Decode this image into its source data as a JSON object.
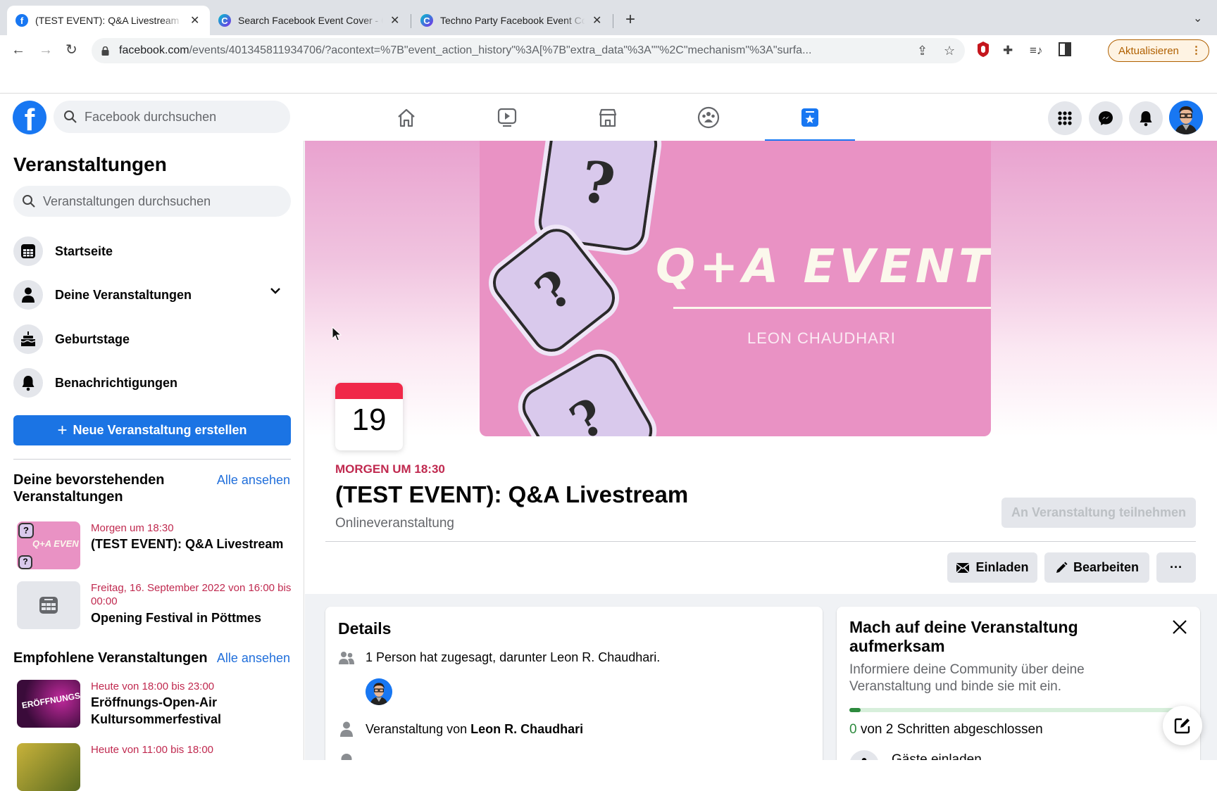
{
  "browser": {
    "tabs": [
      {
        "title": "(TEST EVENT): Q&A Livestream",
        "icon": "facebook-icon",
        "active": true
      },
      {
        "title": "Search Facebook Event Cover - Canva",
        "icon": "canva-icon",
        "active": false
      },
      {
        "title": "Techno Party Facebook Event Cover - Canva",
        "icon": "canva-icon",
        "active": false
      }
    ],
    "url_host": "facebook.com",
    "url_path": "/events/401345811934706/?acontext=%7B\"event_action_history\"%3A[%7B\"extra_data\"%3A\"\"%2C\"mechanism\"%3A\"surfa...",
    "update_label": "Aktualisieren"
  },
  "fb_header": {
    "search_placeholder": "Facebook durchsuchen",
    "nav": [
      "home-icon",
      "watch-icon",
      "marketplace-icon",
      "groups-icon",
      "events-icon"
    ],
    "active_nav": "events-icon"
  },
  "sidebar": {
    "title": "Veranstaltungen",
    "search_placeholder": "Veranstaltungen durchsuchen",
    "items": [
      {
        "label": "Startseite",
        "icon": "calendar-grid-icon"
      },
      {
        "label": "Deine Veranstaltungen",
        "icon": "person-icon",
        "expandable": true
      },
      {
        "label": "Geburtstage",
        "icon": "cake-icon"
      },
      {
        "label": "Benachrichtigungen",
        "icon": "bell-icon"
      }
    ],
    "create_label": "Neue Veranstaltung erstellen",
    "upcoming": {
      "title": "Deine bevorstehenden Veranstaltungen",
      "see_all": "Alle ansehen",
      "events": [
        {
          "when": "Morgen um 18:30",
          "name": "(TEST EVENT): Q&A Livestream"
        },
        {
          "when": "Freitag, 16. September 2022 von 16:00 bis 00:00",
          "name": "Opening Festival in Pöttmes"
        }
      ]
    },
    "recommended": {
      "title": "Empfohlene Veranstaltungen",
      "see_all": "Alle ansehen",
      "events": [
        {
          "when": "Heute von 18:00 bis 23:00",
          "name": "Eröffnungs-Open-Air Kultursommerfestival",
          "thumb_text": "ERÖFFNUNGS-OPEN-AIR"
        },
        {
          "when": "Heute von 11:00 bis 18:00",
          "name": ""
        }
      ]
    }
  },
  "event": {
    "cover": {
      "headline": "Q+A EVENT",
      "author": "LEON CHAUDHARI",
      "thumb_text": "Q+A EVEN"
    },
    "day": "19",
    "when": "MORGEN UM 18:30",
    "title": "(TEST EVENT): Q&A Livestream",
    "type": "Onlineveranstaltung",
    "join_label": "An Veranstaltung teilnehmen",
    "invite_label": "Einladen",
    "edit_label": "Bearbeiten",
    "more_label": "···"
  },
  "details": {
    "title": "Details",
    "attendance": "1 Person hat zugesagt, darunter Leon R. Chaudhari.",
    "host_prefix": "Veranstaltung von ",
    "host_name": "Leon R. Chaudhari"
  },
  "promote": {
    "title": "Mach auf deine Veranstaltung aufmerksam",
    "text": "Informiere deine Community über deine Veranstaltung und binde sie mit ein.",
    "steps_done": "0",
    "steps_text": " von 2 Schritten abgeschlossen",
    "progress": 0,
    "first_step": "Gäste einladen"
  },
  "colors": {
    "brand": "#1877f2",
    "date_accent": "#c0294f",
    "progress": "#2d8a3e"
  }
}
